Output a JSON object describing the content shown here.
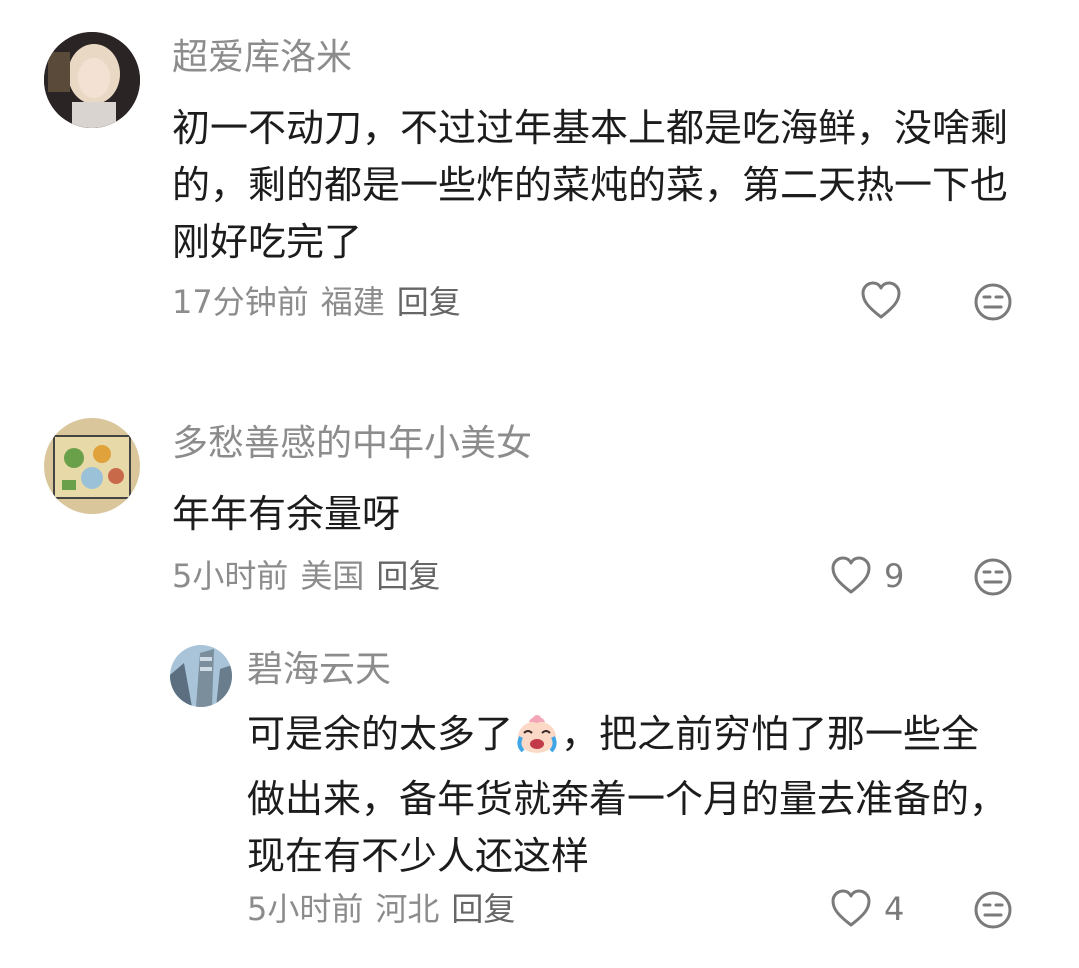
{
  "comments": [
    {
      "username": "超爱库洛米",
      "text": "初一不动刀，不过过年基本上都是吃海鲜，没啥剩的，剩的都是一些炸的菜炖的菜，第二天热一下也刚好吃完了",
      "time": "17分钟前",
      "location": "福建",
      "reply_label": "回复",
      "likes": ""
    },
    {
      "username": "多愁善感的中年小美女",
      "text": "年年有余量呀",
      "time": "5小时前",
      "location": "美国",
      "reply_label": "回复",
      "likes": "9"
    },
    {
      "username": "碧海云天",
      "text_before_emoji": "可是余的太多了",
      "emoji": "crying-laugh-emoji",
      "text_after_emoji": "，把之前穷怕了那一些全做出来，备年货就奔着一个月的量去准备的，现在有不少人还这样",
      "time": "5小时前",
      "location": "河北",
      "reply_label": "回复",
      "likes": "4"
    }
  ]
}
